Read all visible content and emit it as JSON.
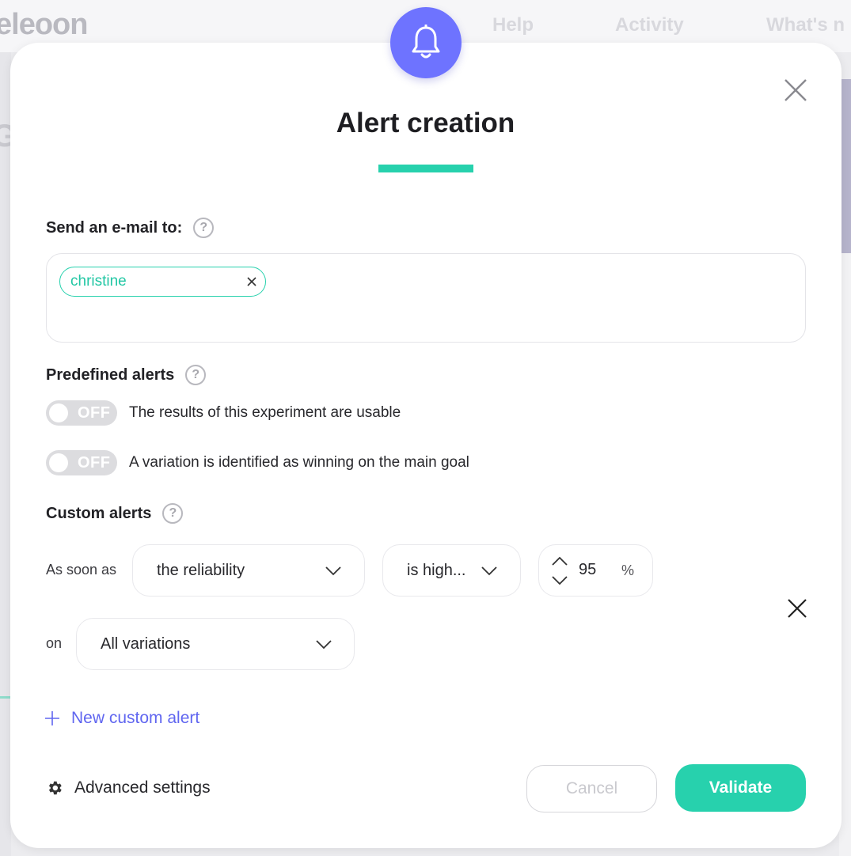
{
  "background": {
    "logo": "eleoon",
    "nav": [
      "Help",
      "Activity",
      "What's n"
    ],
    "left_letter": "G"
  },
  "modal": {
    "title": "Alert creation",
    "email_section": {
      "label": "Send an e-mail to:",
      "recipients": [
        "christine"
      ]
    },
    "predefined_section": {
      "label": "Predefined alerts",
      "toggles": [
        {
          "state": "OFF",
          "label": "The results of this experiment are usable"
        },
        {
          "state": "OFF",
          "label": "A variation is identified as winning on the main goal"
        }
      ]
    },
    "custom_section": {
      "label": "Custom alerts",
      "as_soon_as_label": "As soon as",
      "metric": "the reliability",
      "operator": "is high...",
      "value": "95",
      "unit": "%",
      "on_label": "on",
      "scope": "All variations"
    },
    "new_custom_alert": "New custom alert",
    "advanced_settings": "Advanced settings",
    "cancel_label": "Cancel",
    "validate_label": "Validate",
    "help_glyph": "?"
  },
  "colors": {
    "accent": "#27d1ad",
    "primary": "#6e73ff",
    "link": "#6066f0"
  },
  "icons": [
    "bell-icon",
    "close-icon",
    "help-icon",
    "chip-remove-icon",
    "chevron-down-icon",
    "chevron-up-icon",
    "plus-icon",
    "gear-icon"
  ]
}
